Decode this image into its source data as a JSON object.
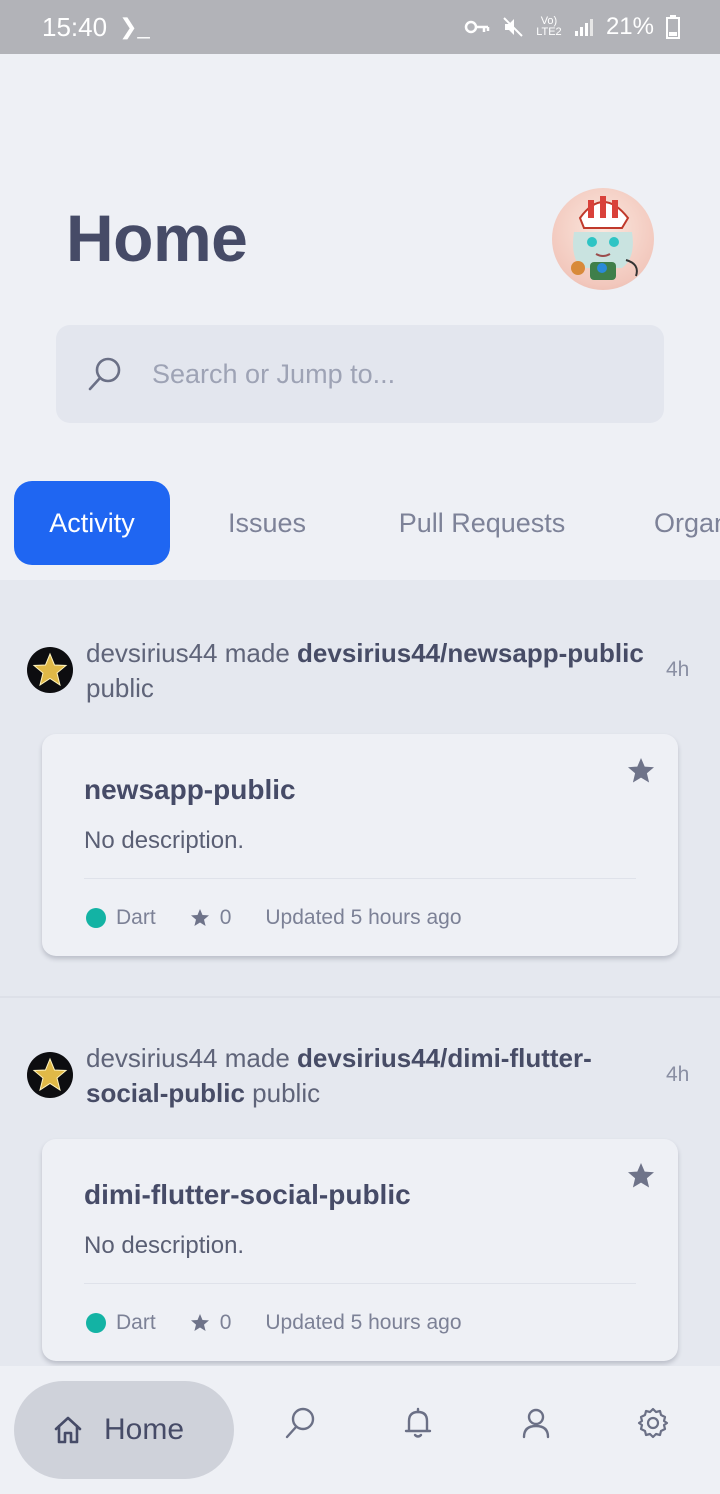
{
  "status_bar": {
    "time": "15:40",
    "terminal_glyph": "❯_",
    "network": "Vo) LTE2",
    "battery": "21%"
  },
  "header": {
    "title": "Home"
  },
  "search": {
    "placeholder": "Search or Jump to..."
  },
  "tabs": [
    {
      "label": "Activity",
      "active": true
    },
    {
      "label": "Issues",
      "active": false
    },
    {
      "label": "Pull Requests",
      "active": false
    },
    {
      "label": "Organizations",
      "active": false
    }
  ],
  "feed": {
    "events": [
      {
        "actor": "devsirius44",
        "verb": "made",
        "repo_full": "devsirius44/newsapp-public",
        "suffix": "public",
        "time": "4h",
        "repo": {
          "name": "newsapp-public",
          "description": "No description.",
          "language": "Dart",
          "language_color": "#13b3a4",
          "stars": "0",
          "updated": "Updated 5 hours ago"
        }
      },
      {
        "actor": "devsirius44",
        "verb": "made",
        "repo_full": "devsirius44/dimi-flutter-social-public",
        "suffix": "public",
        "time": "4h",
        "repo": {
          "name": "dimi-flutter-social-public",
          "description": "No description.",
          "language": "Dart",
          "language_color": "#13b3a4",
          "stars": "0",
          "updated": "Updated 5 hours ago"
        }
      }
    ]
  },
  "bottom_nav": {
    "home_label": "Home",
    "items": [
      "home-icon",
      "search-icon",
      "bell-icon",
      "profile-icon",
      "settings-icon"
    ]
  },
  "colors": {
    "accent": "#1f66f2",
    "title": "#464b67",
    "background": "#eef0f5",
    "feed_background": "#e5e8ef"
  }
}
